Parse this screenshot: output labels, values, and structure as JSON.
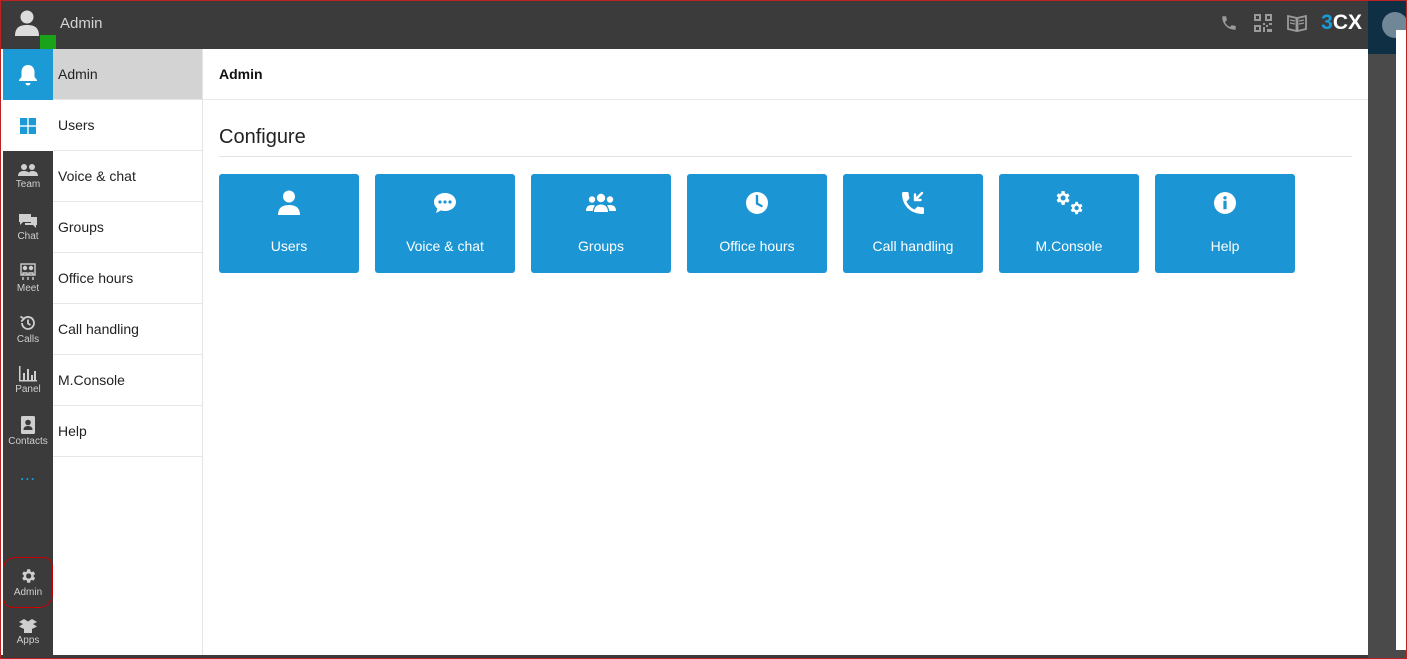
{
  "header": {
    "title": "Admin",
    "brand_prefix": "3",
    "brand_suffix": "CX",
    "icons": [
      "phone-icon",
      "qr-code-icon",
      "book-icon"
    ]
  },
  "rail": {
    "items": [
      {
        "name": "notifications",
        "icon": "bell-icon",
        "label": ""
      },
      {
        "name": "windows",
        "icon": "windows-icon",
        "label": ""
      },
      {
        "name": "team",
        "icon": "team-icon",
        "label": "Team"
      },
      {
        "name": "chat",
        "icon": "chat-icon",
        "label": "Chat"
      },
      {
        "name": "meet",
        "icon": "meet-icon",
        "label": "Meet"
      },
      {
        "name": "calls",
        "icon": "history-icon",
        "label": "Calls"
      },
      {
        "name": "panel",
        "icon": "bar-chart-icon",
        "label": "Panel"
      },
      {
        "name": "contacts",
        "icon": "contacts-icon",
        "label": "Contacts"
      },
      {
        "name": "admin",
        "icon": "gear-icon",
        "label": "Admin"
      },
      {
        "name": "apps",
        "icon": "box-icon",
        "label": "Apps"
      }
    ],
    "more": "⋯"
  },
  "menu": {
    "items": [
      "Admin",
      "Users",
      "Voice & chat",
      "Groups",
      "Office hours",
      "Call handling",
      "M.Console",
      "Help"
    ],
    "active": "Admin"
  },
  "main": {
    "breadcrumb": "Admin",
    "section_title": "Configure",
    "tiles": [
      {
        "label": "Users",
        "icon": "user-icon"
      },
      {
        "label": "Voice & chat",
        "icon": "speech-bubble-icon"
      },
      {
        "label": "Groups",
        "icon": "users-group-icon"
      },
      {
        "label": "Office hours",
        "icon": "clock-icon"
      },
      {
        "label": "Call handling",
        "icon": "incoming-call-icon"
      },
      {
        "label": "M.Console",
        "icon": "gears-icon"
      },
      {
        "label": "Help",
        "icon": "info-icon"
      }
    ]
  },
  "colors": {
    "accent": "#1b9ad6",
    "tile": "#1b95d3",
    "dark": "#3b3b3b",
    "presence": "#1aa31a"
  }
}
